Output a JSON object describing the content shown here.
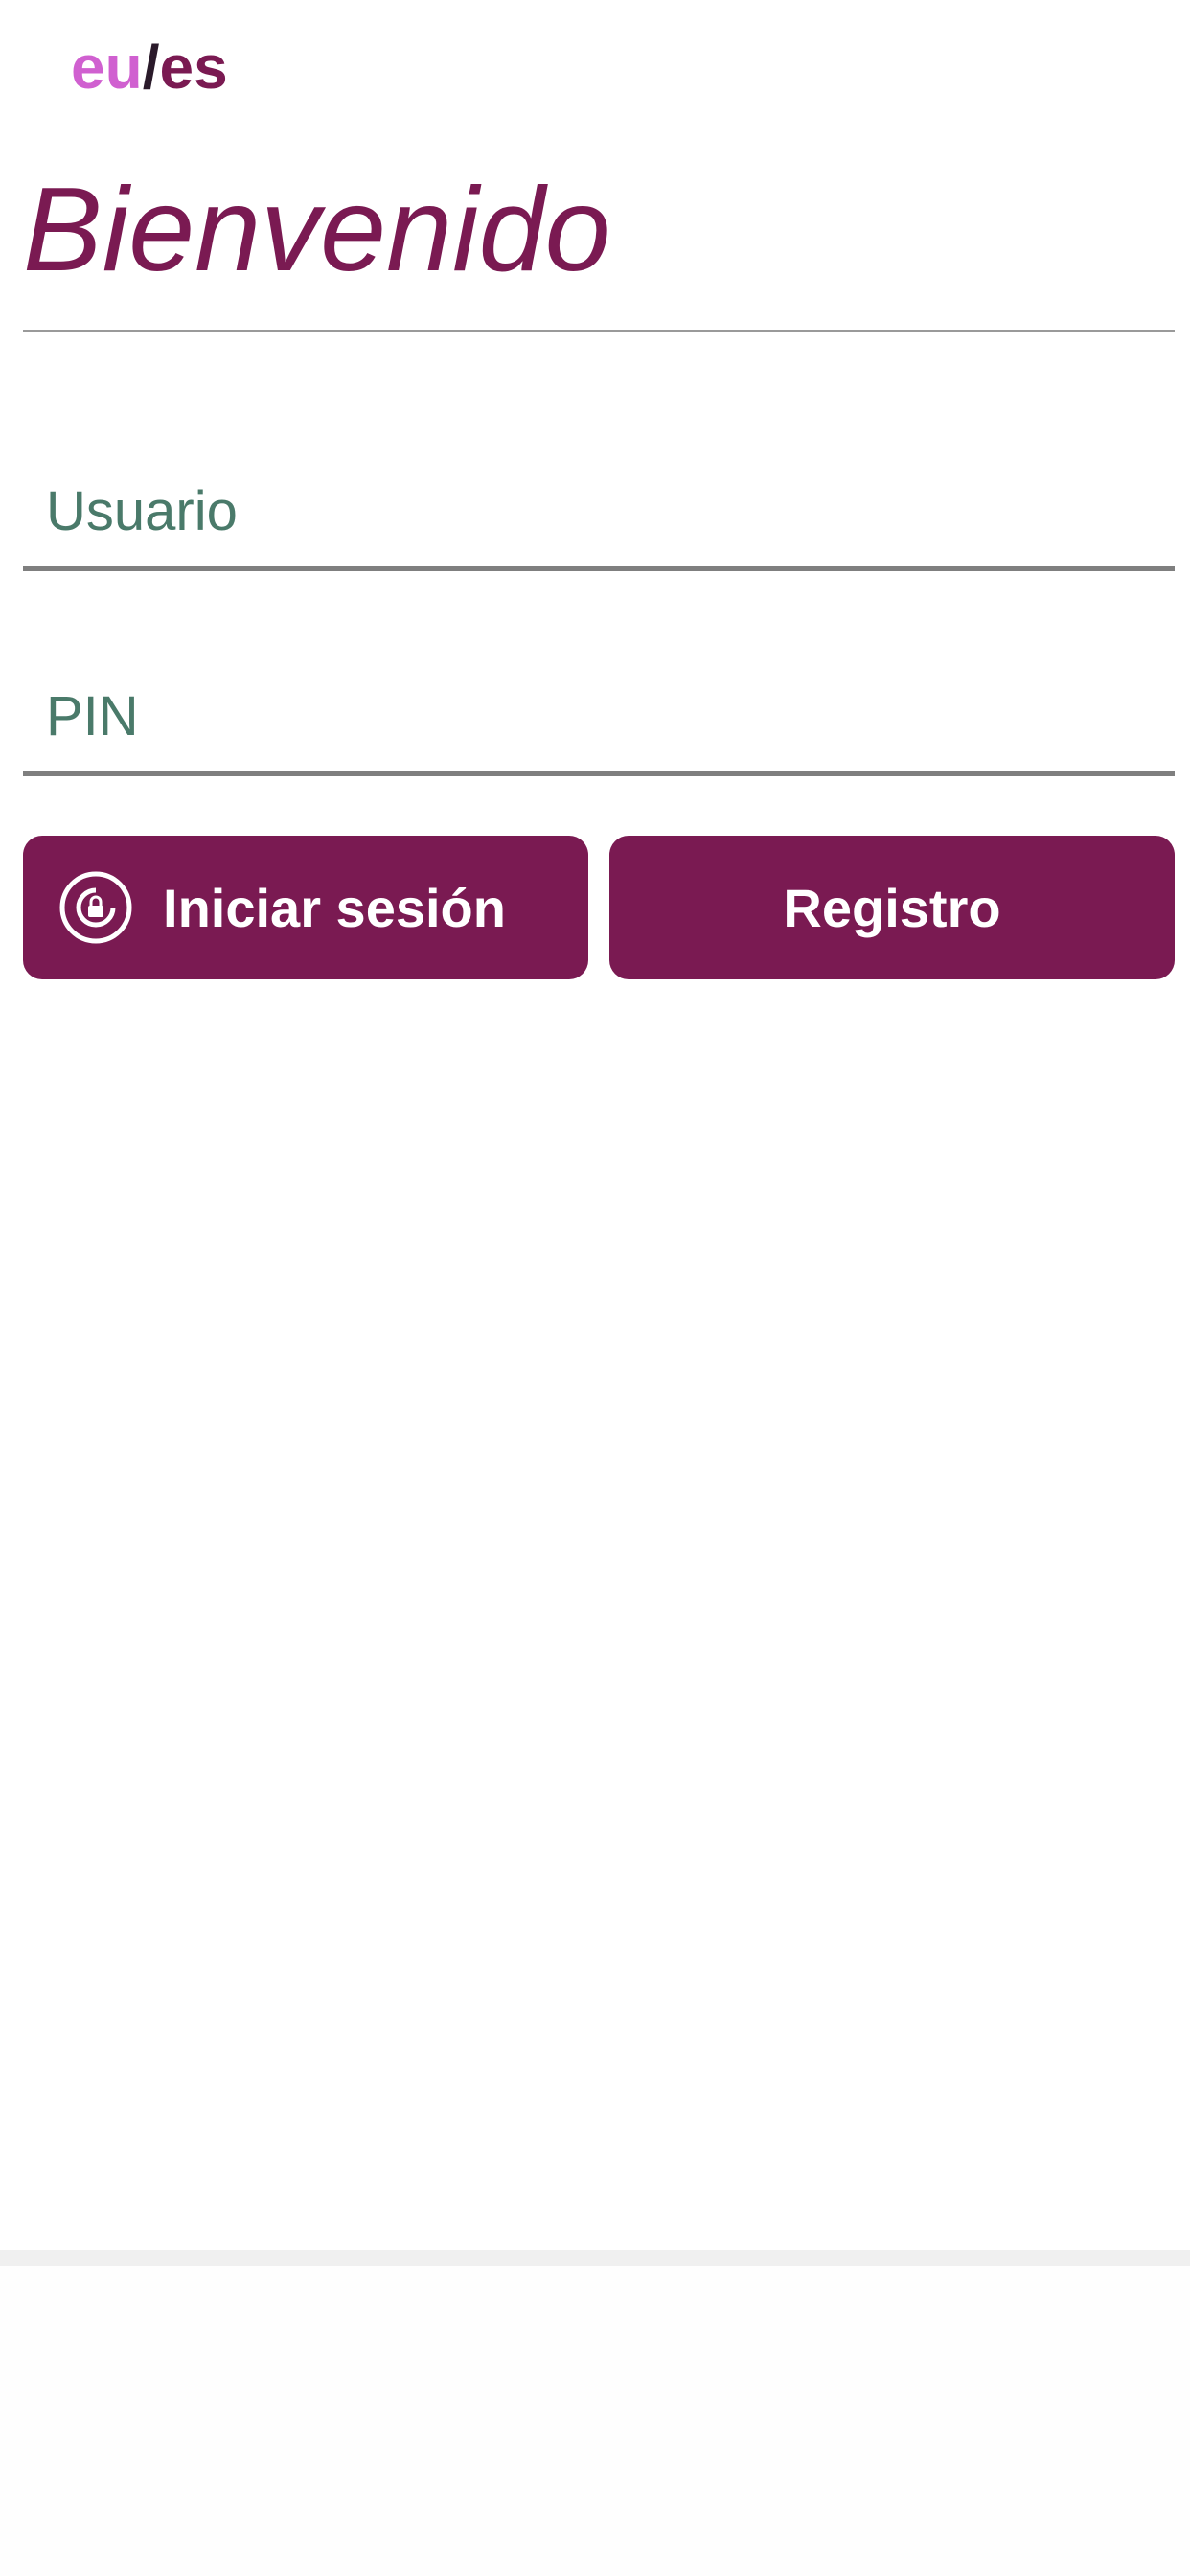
{
  "language_switch": {
    "eu": "eu",
    "separator": "/",
    "es": "es"
  },
  "title": "Bienvenido",
  "form": {
    "user_placeholder": "Usuario",
    "pin_placeholder": "PIN"
  },
  "buttons": {
    "login_label": "Iniciar sesión",
    "register_label": "Registro"
  },
  "colors": {
    "brand": "#7a1a52",
    "eu_accent": "#d060d0",
    "input_text": "#4a7a6a"
  },
  "icons": {
    "login": "lock-circle-icon"
  }
}
